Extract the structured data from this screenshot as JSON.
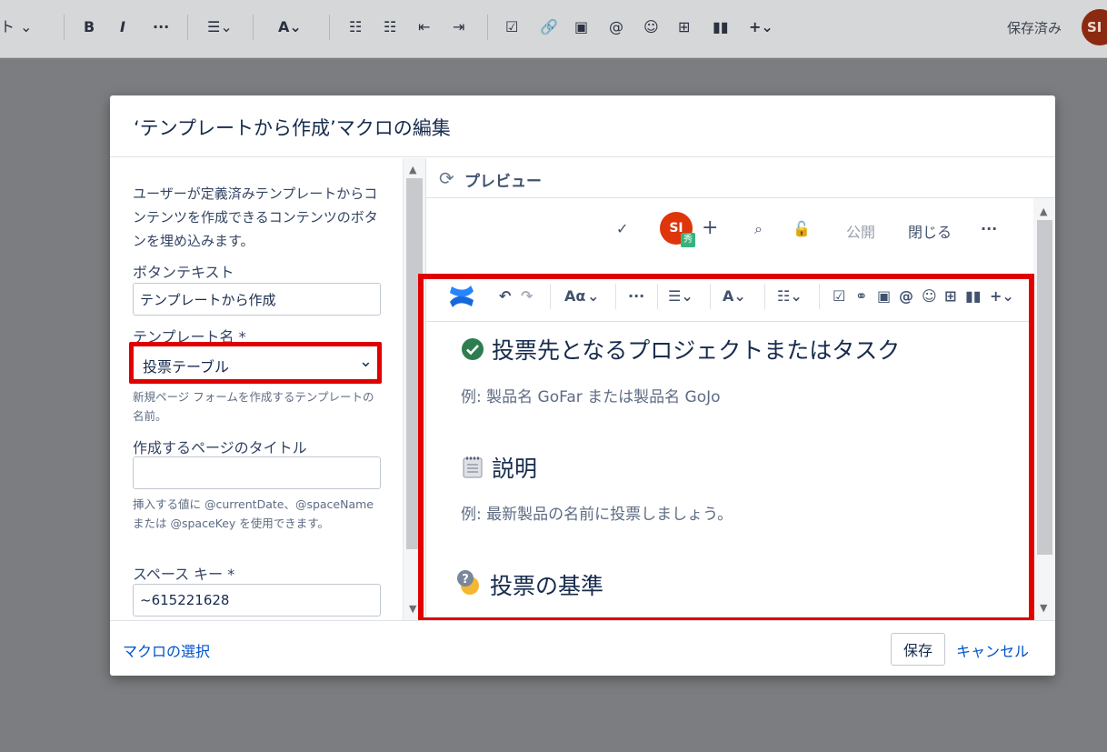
{
  "topbar": {
    "left_fragment": "ト",
    "bold": "B",
    "italic": "I",
    "more": "···",
    "saved_status": "保存済み",
    "avatar_initials": "SI"
  },
  "dialog": {
    "title": "‘テンプレートから作成’マクロの編集",
    "description": "ユーザーが定義済みテンプレートからコンテンツを作成できるコンテンツのボタンを埋め込みます。",
    "fields": {
      "button_text_label": "ボタンテキスト",
      "button_text_value": "テンプレートから作成",
      "template_label": "テンプレート名 *",
      "template_value": "投票テーブル",
      "template_help": "新規ページ フォームを作成するテンプレートの名前。",
      "page_title_label": "作成するページのタイトル",
      "page_title_value": "",
      "page_title_help": "挿入する値に @currentDate、@spaceName または @spaceKey を使用できます。",
      "space_key_label": "スペース キー *",
      "space_key_value": "~615221628"
    },
    "preview": {
      "label": "プレビュー",
      "avatar_initials": "SI",
      "avatar_badge": "秀",
      "publish": "公開",
      "close": "閉じる",
      "more": "···",
      "toolbar_text_style": "Aα",
      "toolbar_more": "···",
      "headings": [
        {
          "text": "投票先となるプロジェクトまたはタスク",
          "example": "例: 製品名 GoFar または製品名 GoJo"
        },
        {
          "text": "説明",
          "example": "例: 最新製品の名前に投票しましょう。"
        },
        {
          "text": "投票の基準"
        }
      ]
    },
    "footer": {
      "select_macro": "マクロの選択",
      "save": "保存",
      "cancel": "キャンセル"
    }
  }
}
